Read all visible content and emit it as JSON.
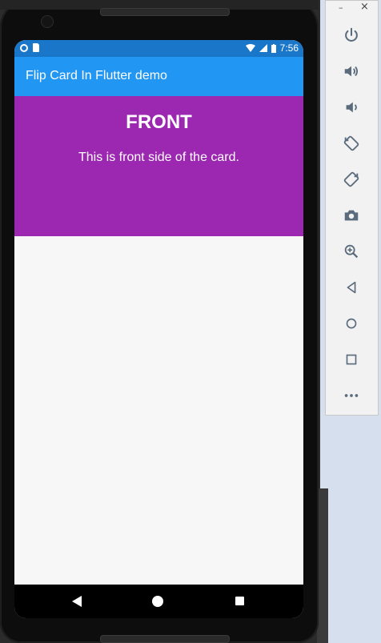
{
  "status_bar": {
    "time": "7:56"
  },
  "app_bar": {
    "title": "Flip Card In Flutter demo"
  },
  "card": {
    "title": "FRONT",
    "text": "This is front side of the card.",
    "color": "#9c27b0"
  },
  "colors": {
    "app_bar": "#2196f3",
    "status_bar": "#1976c8",
    "background": "#f7f7f7"
  },
  "emulator_toolbar": {
    "window_controls": [
      "minimize",
      "close"
    ],
    "buttons": [
      "power-icon",
      "volume-up-icon",
      "volume-down-icon",
      "rotate-left-icon",
      "rotate-right-icon",
      "camera-icon",
      "zoom-icon",
      "back-icon",
      "home-icon",
      "overview-icon",
      "more-icon"
    ],
    "min_label": "–",
    "close_label": "×"
  },
  "nav_bar": {
    "buttons": [
      "back",
      "home",
      "recents"
    ]
  }
}
